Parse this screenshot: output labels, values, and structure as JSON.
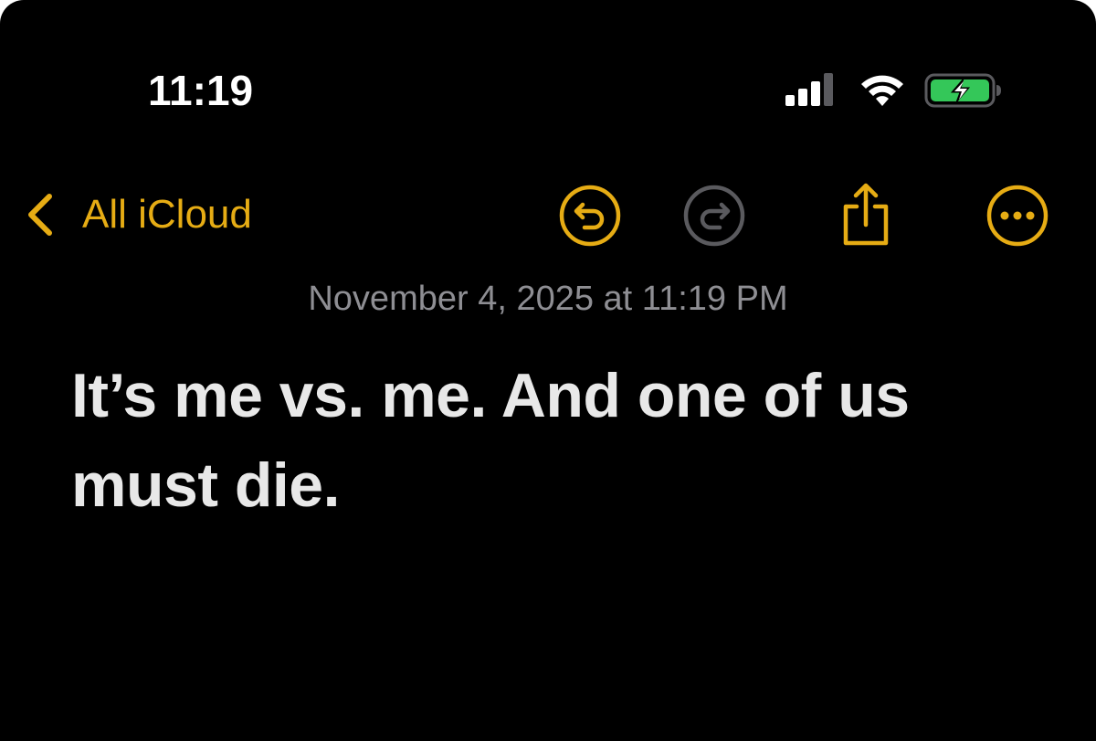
{
  "status_bar": {
    "time": "11:19",
    "signal_icon": "cellular-signal-icon",
    "wifi_icon": "wifi-icon",
    "battery_icon": "battery-charging-icon",
    "battery_color": "#34c759"
  },
  "nav": {
    "back_label": "All iCloud",
    "accent_color": "#e6ac14",
    "icons": [
      "undo-icon",
      "redo-icon",
      "share-icon",
      "more-icon"
    ]
  },
  "note": {
    "date": "November 4, 2025 at 11:19 PM",
    "body": "It’s me vs. me. And one of us must die."
  }
}
